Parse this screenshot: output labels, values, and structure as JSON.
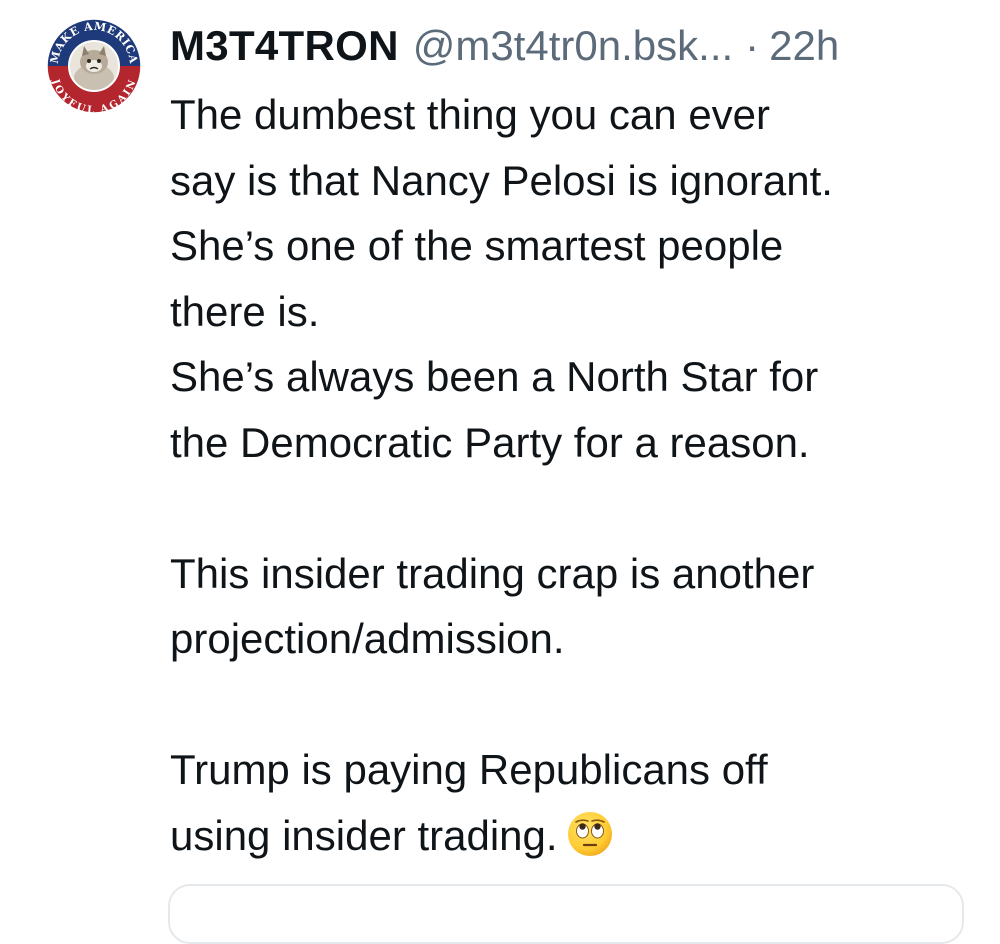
{
  "post": {
    "display_name": "M3T4TRON",
    "handle": "@m3t4tr0n.bsk...",
    "separator": "·",
    "time_ago": "22h",
    "avatar": {
      "icon": "make-america-joyful-again-badge",
      "text_top": "MAKE AMERICA",
      "text_bottom": "JOYFUL AGAIN",
      "colors": {
        "ring_top": "#1f3a7a",
        "ring_bottom": "#b3262e",
        "border": "#ffffff"
      }
    },
    "lines": [
      "The dumbest thing you can ever",
      "say is that Nancy Pelosi is ignorant.",
      "She’s one of the smartest people",
      "there is.",
      "She’s always been a North Star for",
      "the Democratic Party for a reason.",
      "",
      "This insider trading crap is another",
      "projection/admission.",
      "",
      "Trump is paying Republicans off",
      "using insider trading."
    ],
    "trailing_emoji": "face-with-rolling-eyes-emoji"
  },
  "colors": {
    "text": "#0f1419",
    "muted": "#5c6b7a",
    "card_border": "#e6e9ec"
  }
}
